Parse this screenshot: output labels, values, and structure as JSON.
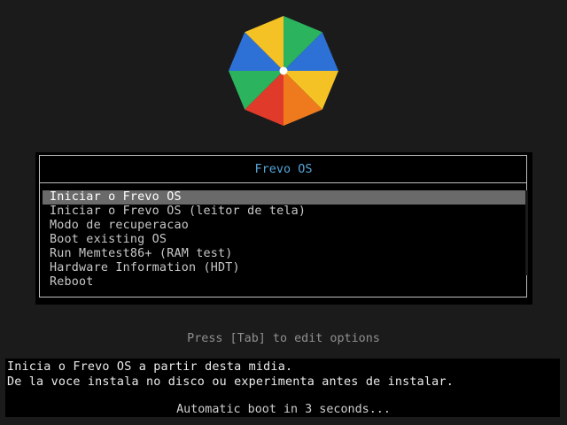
{
  "logo": {
    "name": "frevo-umbrella-logo",
    "colors": {
      "yellow": "#f5c226",
      "green": "#2bb35e",
      "blue": "#2e71d6",
      "red": "#e03a2a",
      "orange": "#ee7a1d"
    }
  },
  "menu": {
    "title": "Frevo OS",
    "selected_index": 0,
    "items": [
      {
        "label": "Iniciar o Frevo OS"
      },
      {
        "label": "Iniciar o Frevo OS (leitor de tela)"
      },
      {
        "label": "Modo de recuperacao"
      },
      {
        "label": "Boot existing OS"
      },
      {
        "label": "Run Memtest86+ (RAM test)"
      },
      {
        "label": "Hardware Information (HDT)"
      },
      {
        "label": "Reboot"
      }
    ]
  },
  "hint": "Press [Tab] to edit options",
  "help": {
    "line1": "Inicia o Frevo OS a partir desta midia.",
    "line2": "De la voce instala no disco ou experimenta antes de instalar."
  },
  "autoboot": "Automatic boot in 3 seconds...",
  "colors": {
    "background": "#1b1b1b",
    "title": "#55a6d9",
    "selection": "#6a6a6a",
    "text": "#c8c8c8"
  }
}
